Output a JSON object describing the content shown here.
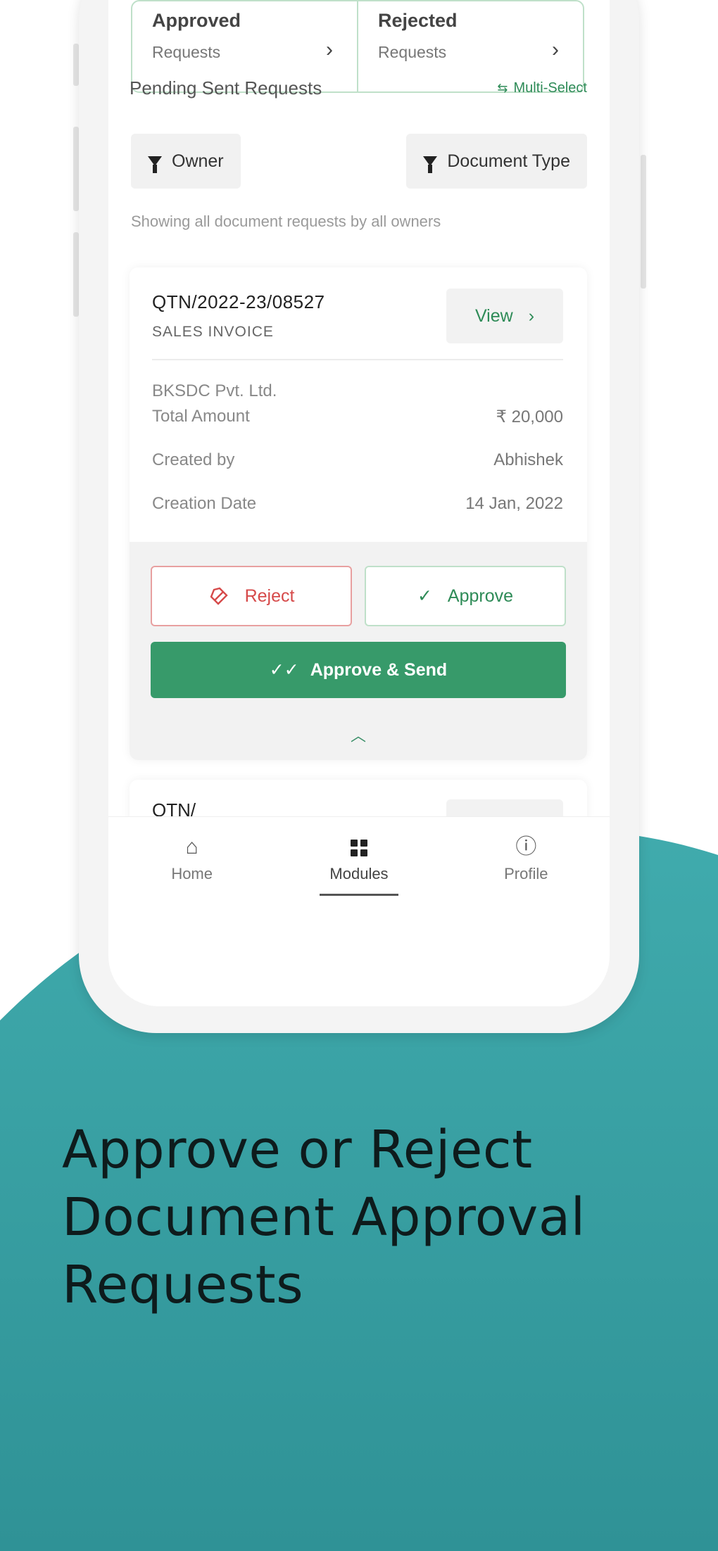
{
  "status_cards": [
    {
      "title": "Approved",
      "subtitle": "Requests"
    },
    {
      "title": "Rejected",
      "subtitle": "Requests"
    }
  ],
  "section": {
    "title": "Pending Sent Requests",
    "multi_select": "Multi-Select"
  },
  "filters": {
    "owner": "Owner",
    "document_type": "Document Type"
  },
  "hint": "Showing all document requests by all owners",
  "request": {
    "doc_number": "QTN/2022-23/08527",
    "doc_type": "SALES INVOICE",
    "view_label": "View",
    "company": "BKSDC Pvt. Ltd.",
    "fields": [
      {
        "label": "Total Amount",
        "value": "₹ 20,000"
      },
      {
        "label": "Created by",
        "value": "Abhishek"
      },
      {
        "label": "Creation Date",
        "value": "14 Jan, 2022"
      }
    ],
    "reject_label": "Reject",
    "approve_label": "Approve",
    "approve_send_label": "Approve & Send"
  },
  "next_request": {
    "doc_number": "QTN/"
  },
  "nav": {
    "home": "Home",
    "modules": "Modules",
    "profile": "Profile"
  },
  "headline": [
    "Approve or Reject",
    "Document Approval",
    "Requests"
  ],
  "colors": {
    "accent": "#379a6a",
    "teal": "#3aa3a7",
    "reject": "#d64a4a"
  }
}
